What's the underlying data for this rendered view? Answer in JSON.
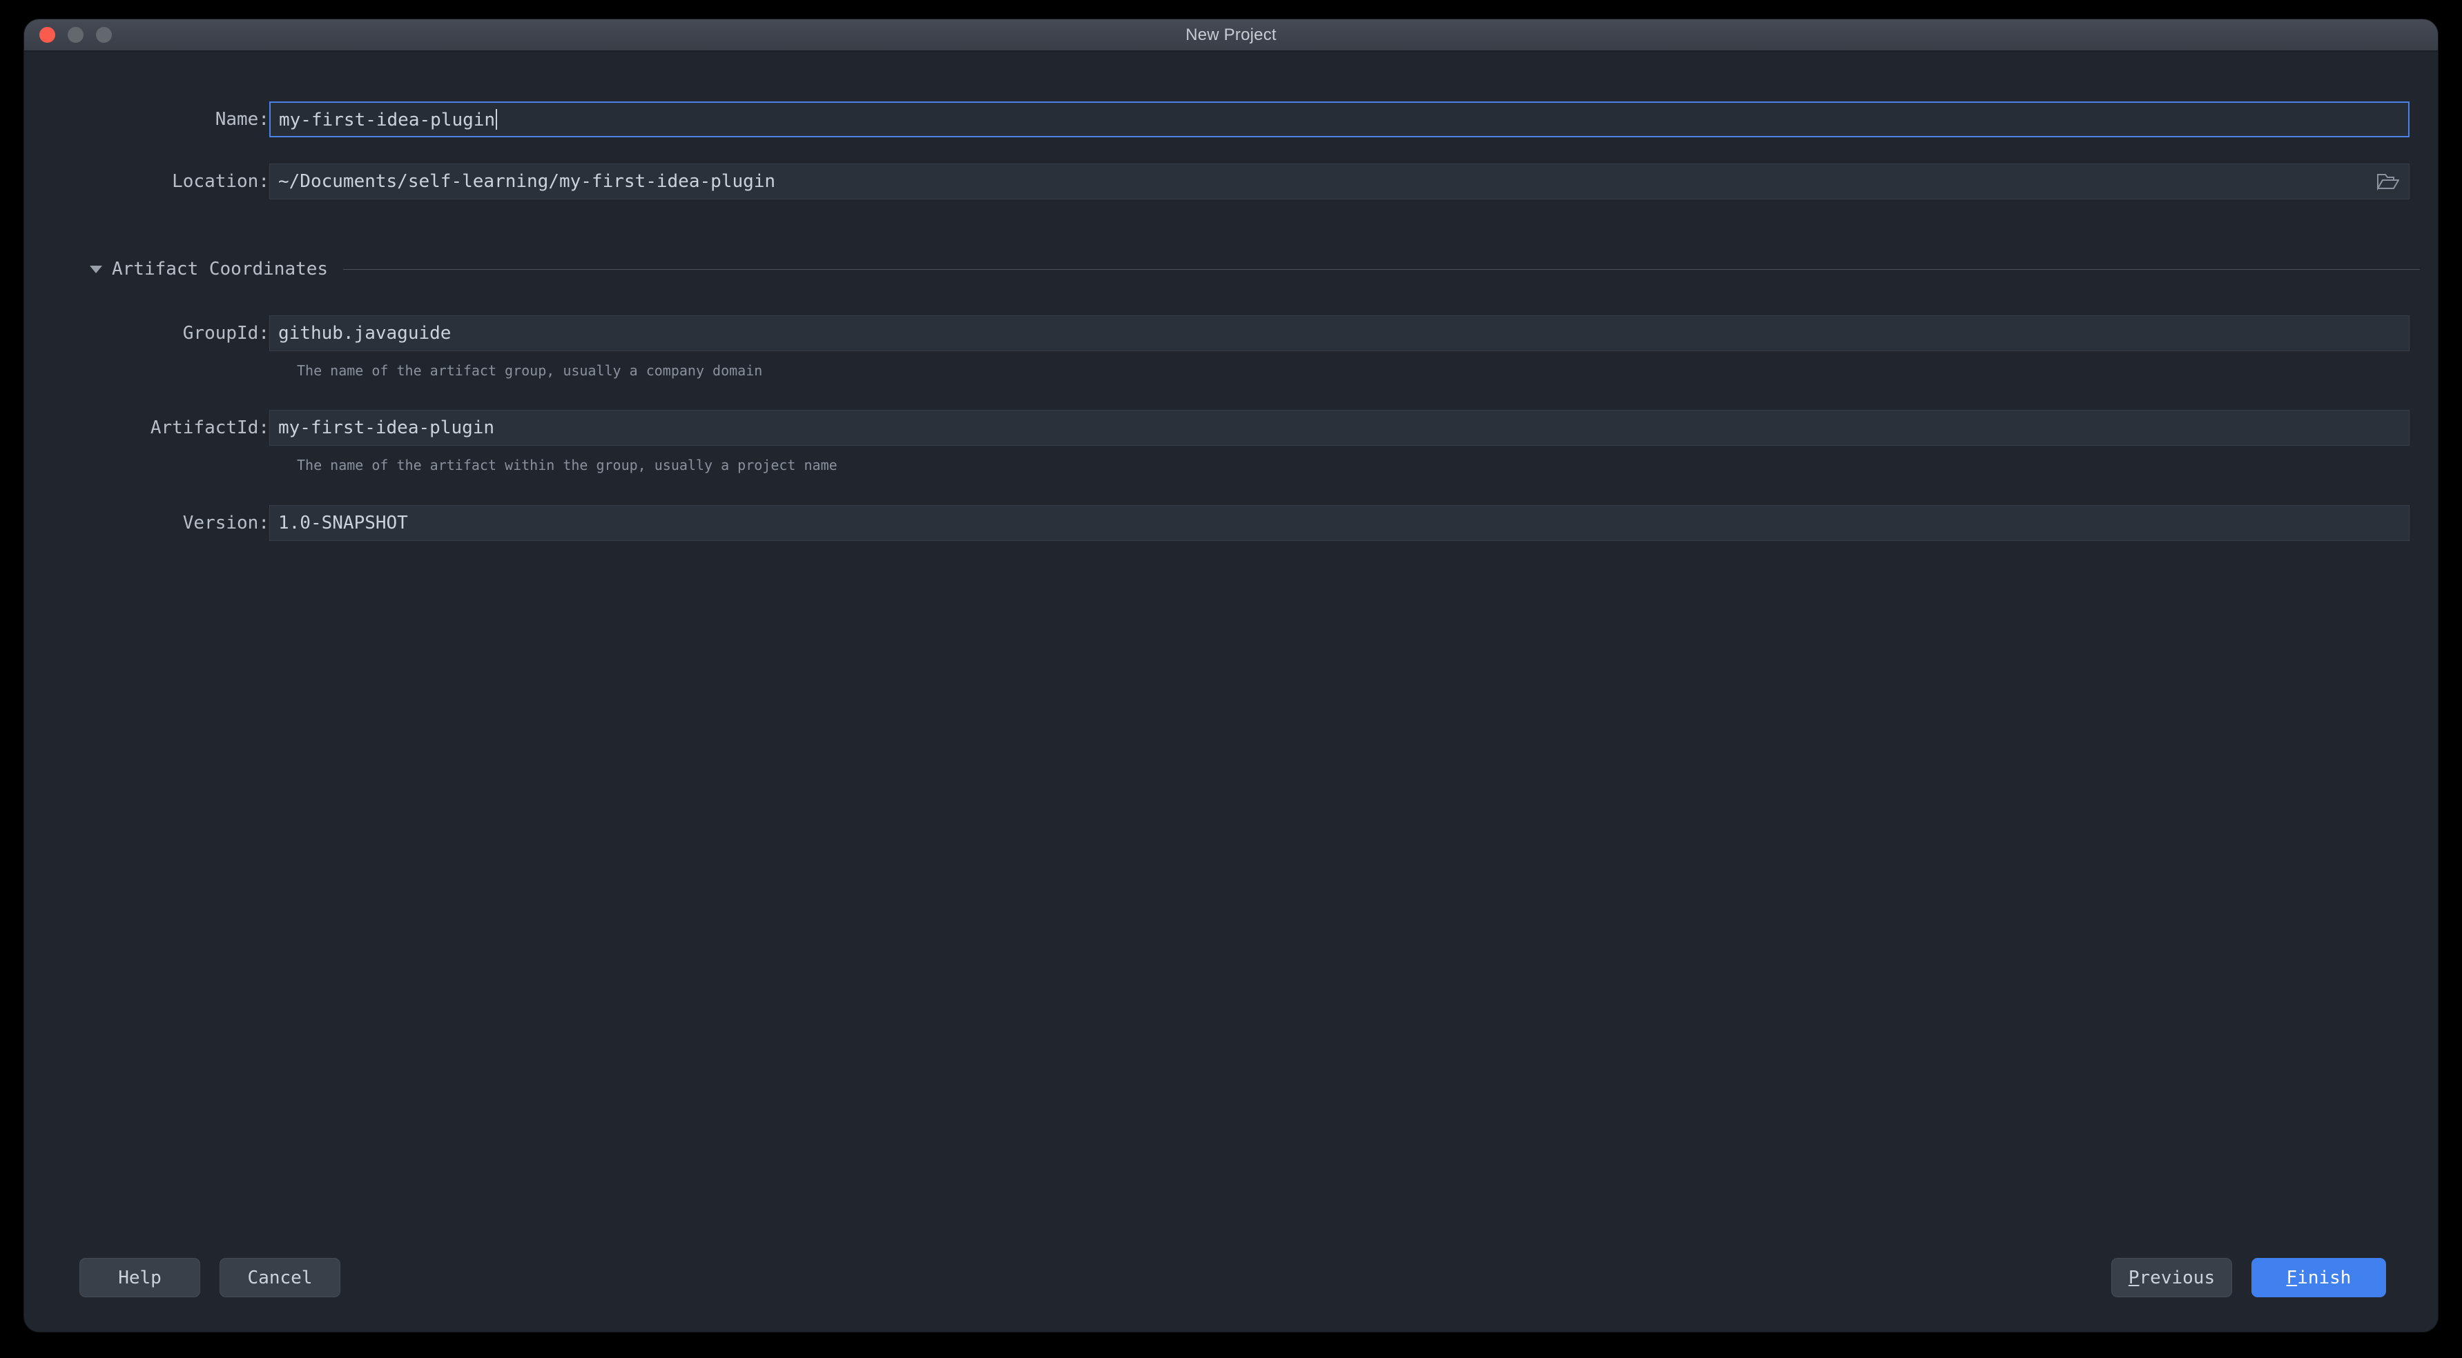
{
  "window": {
    "title": "New Project",
    "traffic_lights": [
      "close",
      "minimize",
      "zoom"
    ]
  },
  "form": {
    "name": {
      "label": "Name:",
      "value": "my-first-idea-plugin",
      "focused": true
    },
    "location": {
      "label": "Location:",
      "value": "~/Documents/self-learning/my-first-idea-plugin",
      "browse_icon": "folder-open-icon"
    },
    "artifact_coordinates": {
      "section_title": "Artifact Coordinates",
      "expanded": true,
      "collapse_icon": "chevron-down-icon",
      "group_id": {
        "label": "GroupId:",
        "value": "github.javaguide",
        "hint": "The name of the artifact group, usually a company domain"
      },
      "artifact_id": {
        "label": "ArtifactId:",
        "value": "my-first-idea-plugin",
        "hint": "The name of the artifact within the group, usually a project name"
      },
      "version": {
        "label": "Version:",
        "value": "1.0-SNAPSHOT"
      }
    }
  },
  "footer": {
    "help_label": "Help",
    "cancel_label": "Cancel",
    "previous": {
      "mnemonic": "P",
      "rest": "revious"
    },
    "finish": {
      "mnemonic": "F",
      "rest": "inish"
    }
  },
  "colors": {
    "accent": "#4080ef",
    "focus_border": "#4b82e8",
    "dialog_bg": "#21262e",
    "input_bg": "#2b313b",
    "titlebar_bg": "#3e434d",
    "close_dot": "#fa5b4d",
    "inactive_dot": "#63686e",
    "text_primary": "#ccd2dc",
    "text_secondary": "#8a919d"
  }
}
